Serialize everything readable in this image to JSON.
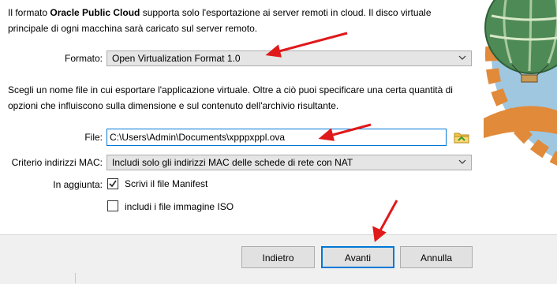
{
  "intro": {
    "part1": "Il formato ",
    "bold": "Oracle Public Cloud",
    "part2": " supporta solo l'esportazione ai server remoti in cloud. Il disco virtuale principale di ogni macchina sarà caricato sul server remoto."
  },
  "format": {
    "label": "Formato:",
    "value": "Open Virtualization Format 1.0"
  },
  "description": "Scegli un nome file in cui esportare l'applicazione virtuale. Oltre a ciò puoi specificare una certa quantità di opzioni che influiscono sulla dimensione e sul contenuto dell'archivio risultante.",
  "file": {
    "label": "File:",
    "value": "C:\\Users\\Admin\\Documents\\xpppxppl.ova"
  },
  "mac_policy": {
    "label": "Criterio indirizzi MAC:",
    "value": "Includi solo gli indirizzi MAC delle schede di rete con NAT"
  },
  "additional": {
    "label": "In aggiunta:",
    "options": [
      {
        "label": "Scrivi il file Manifest",
        "checked": true
      },
      {
        "label": "includi i file immagine ISO",
        "checked": false
      }
    ]
  },
  "buttons": {
    "back": "Indietro",
    "next": "Avanti",
    "cancel": "Annulla"
  },
  "colors": {
    "annotation_arrow": "#e0191b",
    "focus_blue": "#0078d7",
    "balloon_green": "#4e8a55",
    "sky_blue": "#9fc7e0"
  }
}
